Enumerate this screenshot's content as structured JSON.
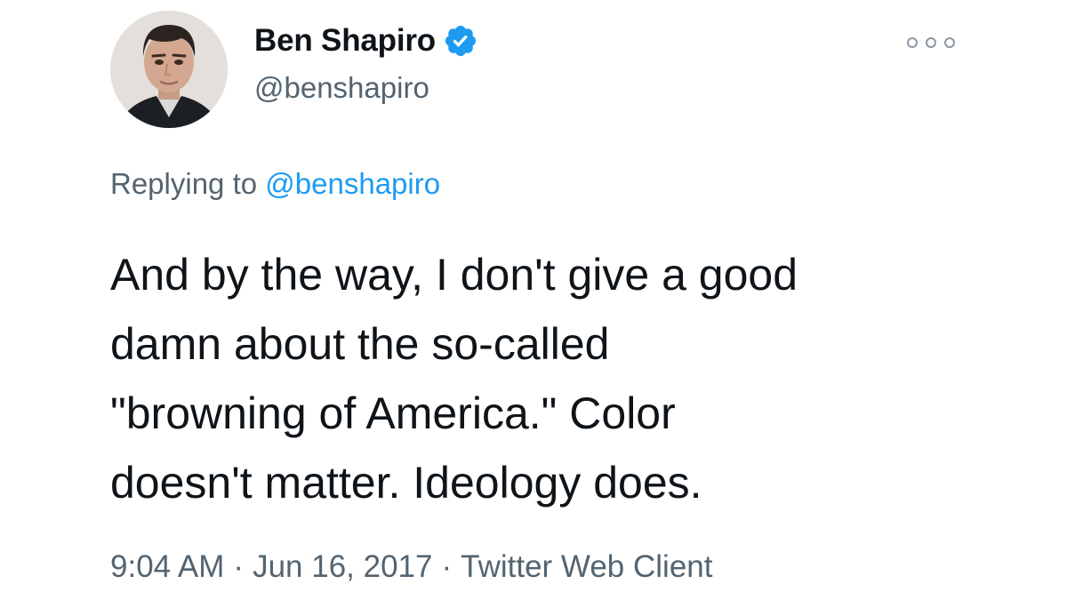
{
  "author": {
    "display_name": "Ben Shapiro",
    "handle": "@benshapiro",
    "verified": true,
    "avatar_icon": "user-avatar"
  },
  "reply": {
    "prefix": "Replying to",
    "mention": "@benshapiro"
  },
  "tweet": {
    "lines": [
      "And by the way, I don't give a good",
      "damn about the so-called",
      "\"browning of America.\" Color",
      "doesn't matter. Ideology does."
    ]
  },
  "meta": {
    "time": "9:04 AM",
    "separator": "·",
    "date": "Jun 16, 2017",
    "client": "Twitter Web Client"
  },
  "colors": {
    "text": "#0f1419",
    "secondary": "#536471",
    "accent": "#1d9bf0",
    "verified_badge": "#1d9bf0"
  },
  "icons": {
    "verified": "verified-badge-icon",
    "more": "more-options-icon"
  }
}
